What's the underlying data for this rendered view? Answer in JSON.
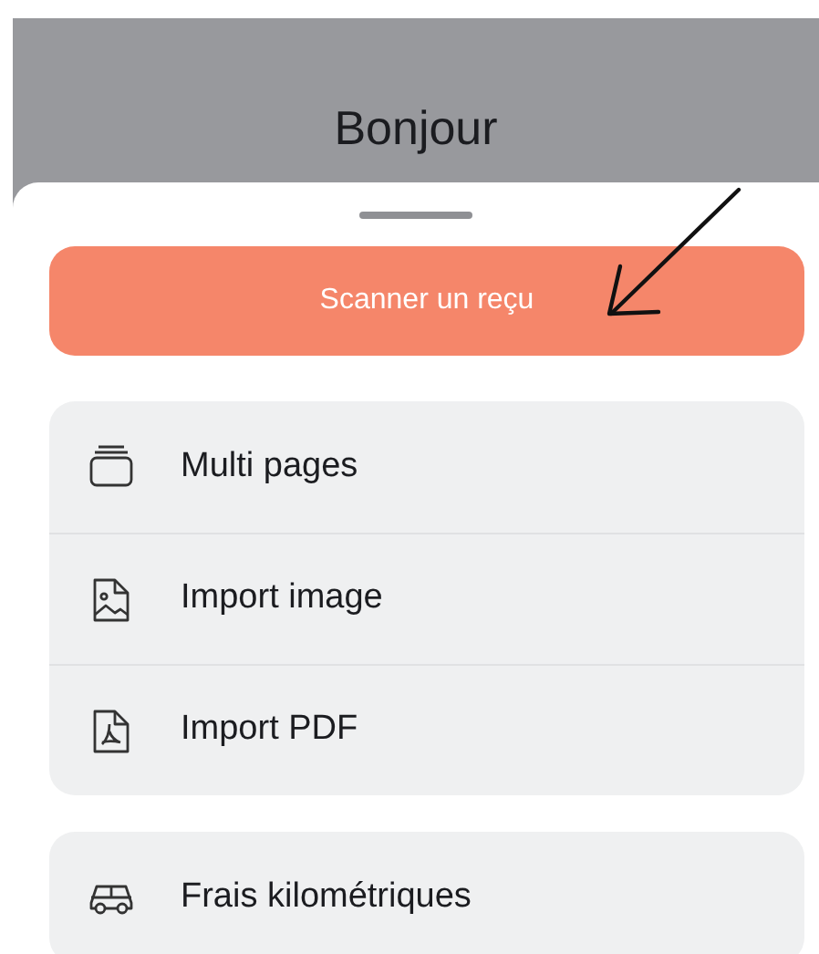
{
  "header": {
    "title": "Bonjour"
  },
  "sheet": {
    "primary_button": "Scanner un reçu",
    "groups": [
      {
        "items": [
          {
            "kind": "pages",
            "label": "Multi pages"
          },
          {
            "kind": "image",
            "label": "Import image"
          },
          {
            "kind": "pdf",
            "label": "Import PDF"
          }
        ]
      },
      {
        "items": [
          {
            "kind": "car",
            "label": "Frais kilométriques"
          }
        ]
      }
    ]
  }
}
